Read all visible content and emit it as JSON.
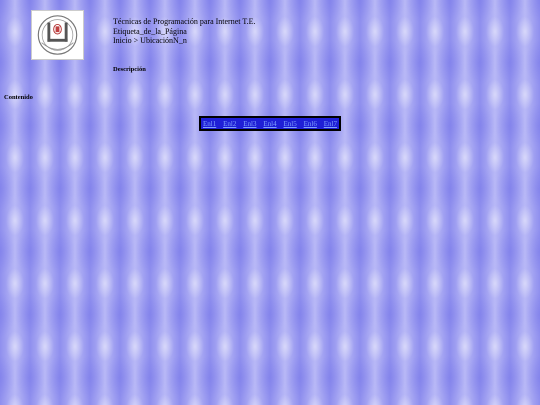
{
  "header": {
    "line1": "Técnicas de Programación para Internet T.E.",
    "line2": "Etiqueta_de_la_Página",
    "line3": "Inicio > UbicaciónN_n"
  },
  "description_label": "Descripción",
  "content_label": "Contenido",
  "nav": {
    "links": [
      "Enl1",
      "Enl2",
      "Enl3",
      "Enl4",
      "Enl5",
      "Enl6",
      "Enl7"
    ]
  },
  "colors": {
    "background": "#a3a3f2",
    "nav_background": "#1f1fd6",
    "nav_border": "#000000",
    "nav_link": "#7fa0ff"
  }
}
